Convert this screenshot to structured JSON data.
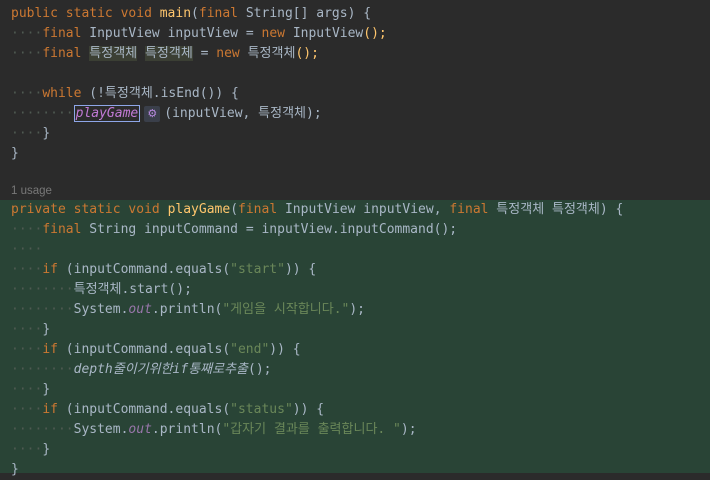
{
  "code": {
    "main_sig": [
      "public",
      "static",
      "void",
      "main",
      "(",
      "final",
      "String[] args",
      ") {"
    ],
    "l1": {
      "kw": "final",
      "type": "InputView",
      "var": "inputView",
      "eq": " = ",
      "new": "new",
      "ctor": "InputView",
      "end": "();"
    },
    "l2": {
      "kw": "final",
      "type": "특정객체",
      "var": "특정객체",
      "eq": " = ",
      "new": "new",
      "ctor": "특정객체",
      "end": "();"
    },
    "l4": {
      "kw": "while",
      "rest": " (!특정객체.isEnd()) {"
    },
    "l5": {
      "call": "playGame",
      "gear": "⚙",
      "args": "(inputView, 특정객체);"
    },
    "l6": "}",
    "l7": "}",
    "usage": "1 usage",
    "play_sig": {
      "private": "private",
      "static": "static",
      "void": "void",
      "name": "playGame",
      "open": "(",
      "final1": "final",
      "p1": " InputView inputView, ",
      "final2": "final",
      "p2": " 특정객체 특정객체) {"
    },
    "p1": {
      "kw": "final",
      "rest": " String inputCommand = inputView.inputCommand();"
    },
    "if1": {
      "kw": "if",
      "pre": " (inputCommand.equals(",
      "str": "\"start\"",
      "post": ")) {"
    },
    "start_call": "특정객체.start();",
    "sys1": {
      "pre": "System.",
      "out": "out",
      "mid": ".println(",
      "str": "\"게임을 시작합니다.\"",
      "post": ");"
    },
    "close1": "}",
    "if2": {
      "kw": "if",
      "pre": " (inputCommand.equals(",
      "str": "\"end\"",
      "post": ")) {"
    },
    "depth": {
      "it": "depth줄이기위한if통째로추출",
      "post": "();"
    },
    "close2": "}",
    "if3": {
      "kw": "if",
      "pre": " (inputCommand.equals(",
      "str": "\"status\"",
      "post": ")) {"
    },
    "sys2": {
      "pre": "System.",
      "out": "out",
      "mid": ".println(",
      "str": "\"갑자기 결과를 출력합니다. \"",
      "post": ");"
    },
    "close3": "}",
    "close4": "}"
  },
  "colors": {
    "background": "#2b2b2b",
    "highlight": "#294436",
    "keyword": "#cc7832",
    "function": "#ffc66d",
    "string": "#6a8759",
    "static_field": "#9876aa"
  }
}
